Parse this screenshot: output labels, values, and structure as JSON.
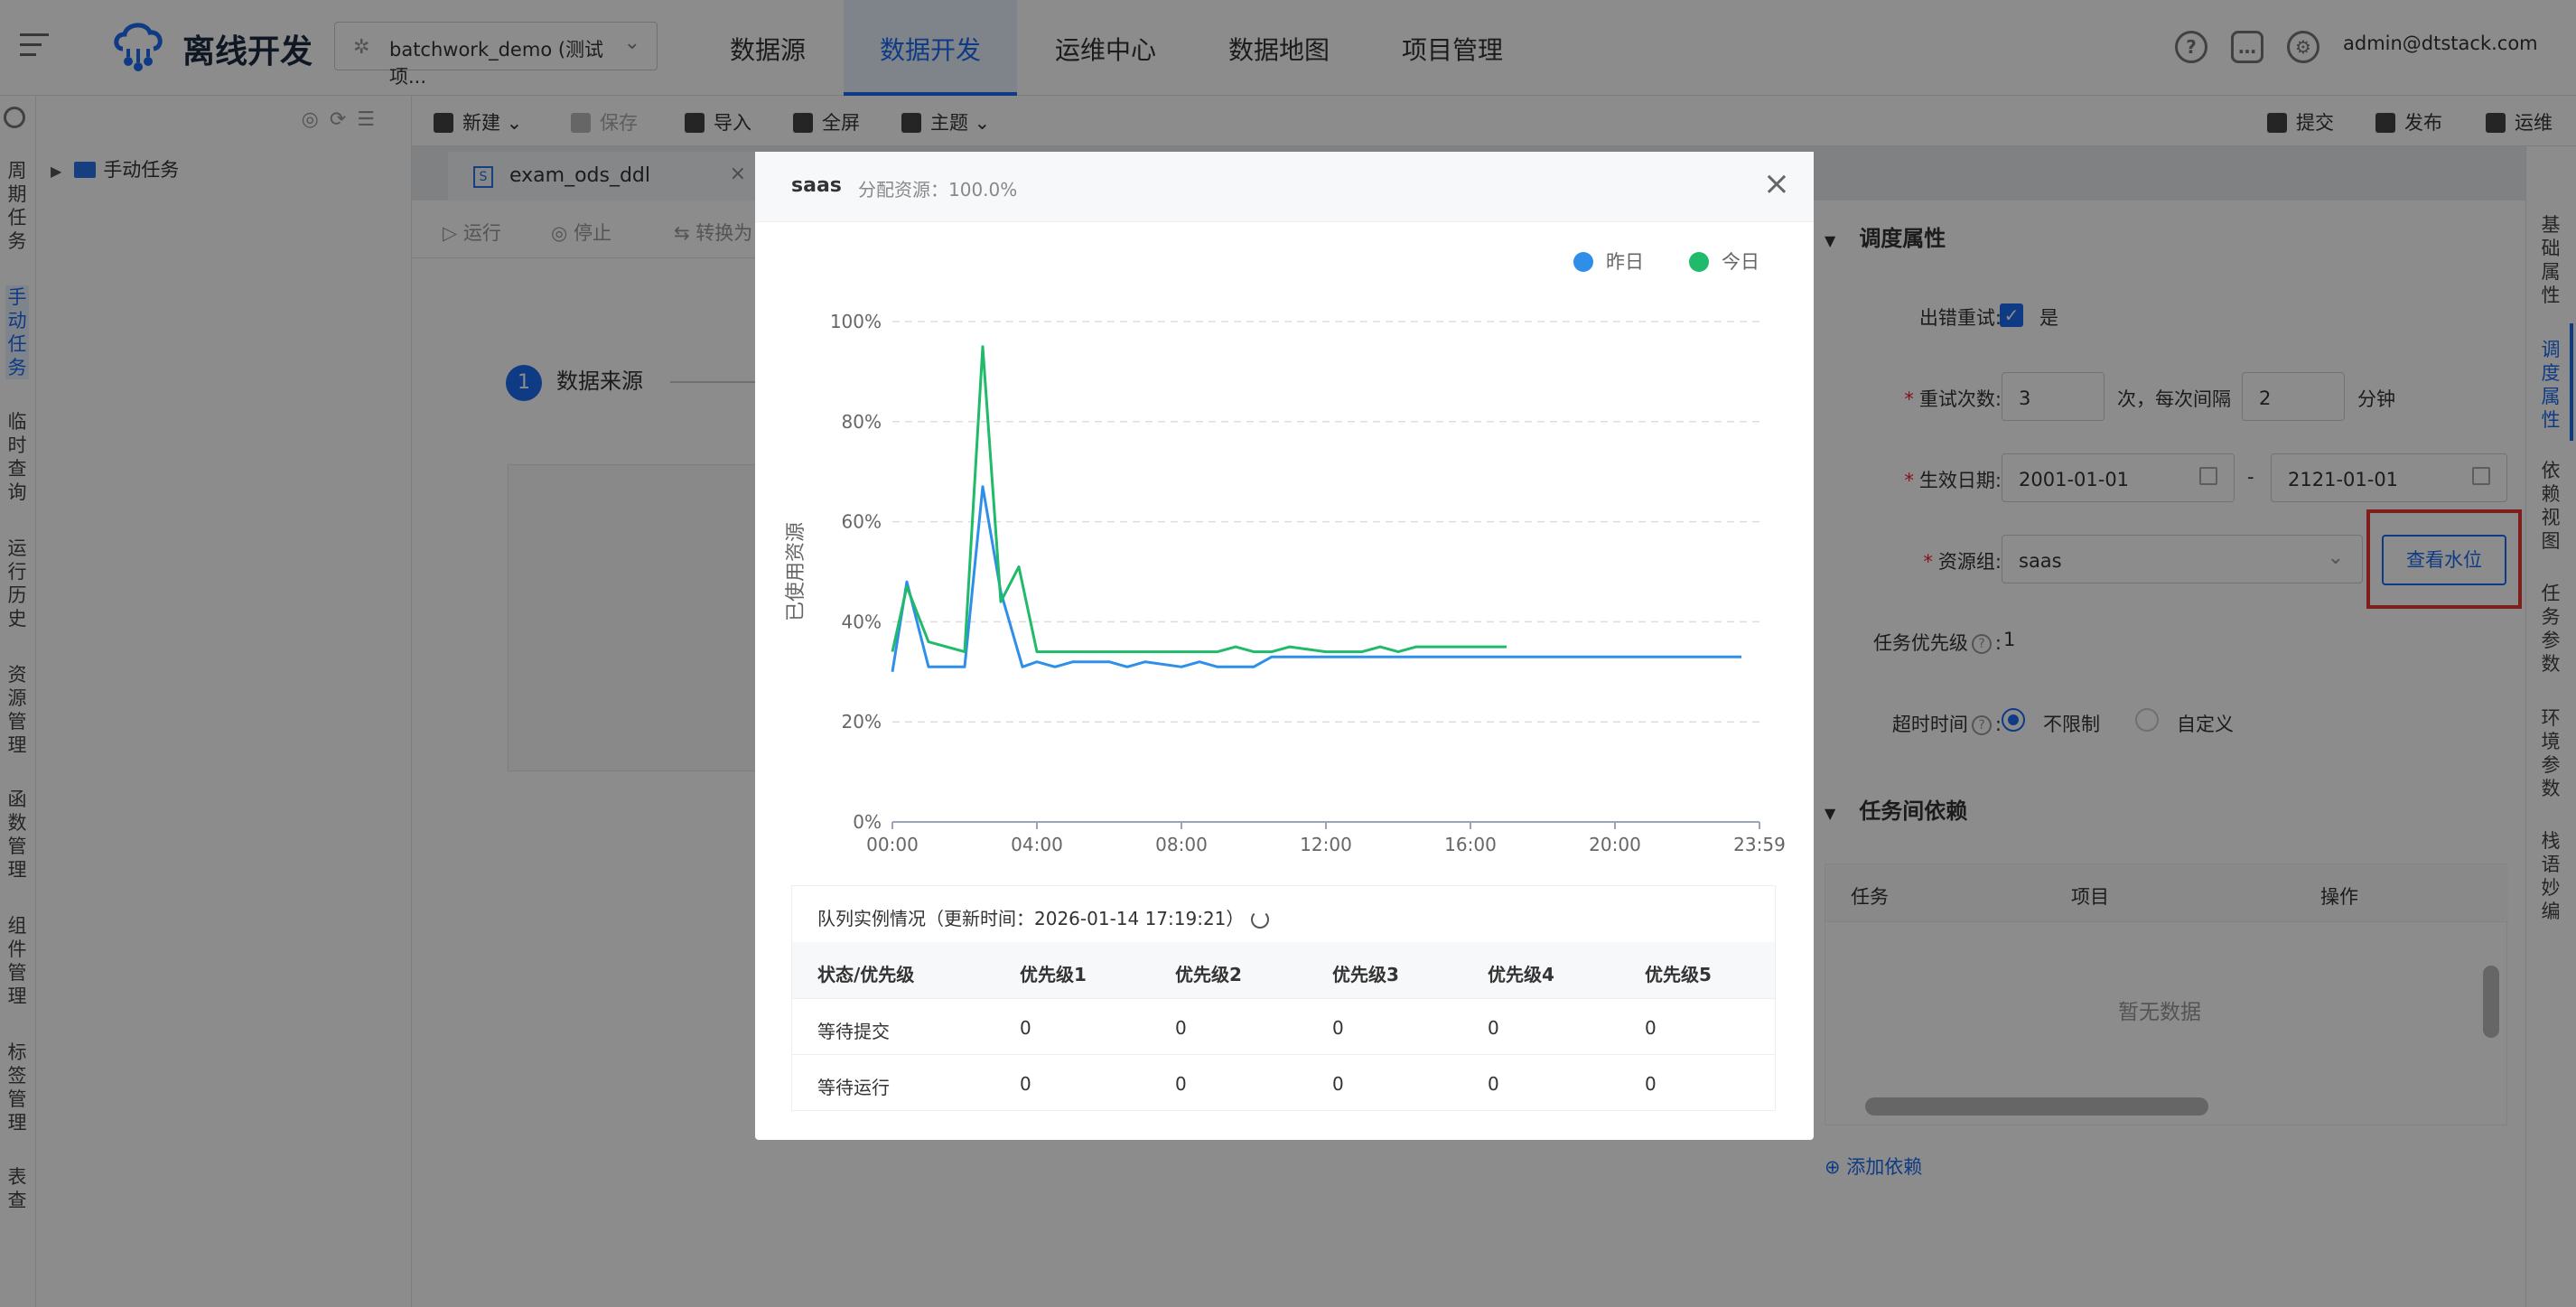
{
  "app": {
    "title": "离线开发",
    "user": "admin@dtstack.com"
  },
  "project_select": {
    "value": "batchwork_demo (测试项..."
  },
  "top_menu": [
    "数据源",
    "数据开发",
    "运维中心",
    "数据地图",
    "项目管理"
  ],
  "left_nav": [
    "周期任务",
    "手动任务",
    "临时查询",
    "运行历史",
    "资源管理",
    "函数管理",
    "组件管理",
    "标签管理",
    "表查询"
  ],
  "tree": {
    "root": "手动任务"
  },
  "toolbar": {
    "new": "新建",
    "save": "保存",
    "import": "导入",
    "fullscreen": "全屏",
    "theme": "主题",
    "submit": "提交",
    "publish": "发布",
    "ops": "运维"
  },
  "editor": {
    "tab": "exam_ods_ddl",
    "run": "运行",
    "stop": "停止",
    "convert": "转换为",
    "step1": "数据来源",
    "step1_num": "1"
  },
  "right_panel": {
    "section1": "调度属性",
    "retry_label": "出错重试:",
    "retry_value": "是",
    "retry_count_label": "重试次数:",
    "retry_count": "3",
    "interval_text": "次，每次间隔",
    "interval": "2",
    "minute": "分钟",
    "effective_label": "生效日期:",
    "start_date": "2001-01-01",
    "date_sep": "-",
    "end_date": "2121-01-01",
    "resource_label": "资源组:",
    "resource_value": "saas",
    "water_button": "查看水位",
    "priority_label": "任务优先级",
    "priority_value": "1",
    "timeout_label": "超时时间",
    "timeout_opt1": "不限制",
    "timeout_opt2": "自定义",
    "section2": "任务间依赖",
    "dep_cols": [
      "任务",
      "项目",
      "操作"
    ],
    "dep_empty": "暂无数据",
    "add_dep": "添加依赖"
  },
  "right_tabs": [
    "基础属性",
    "调度属性",
    "依赖视图",
    "任务参数",
    "环境参数",
    "栈语妙编"
  ],
  "modal": {
    "title": "saas",
    "subtitle": "分配资源：100.0%",
    "legend": [
      "昨日",
      "今日"
    ],
    "table_caption": "队列实例情况（更新时间：2026-01-14 17:19:21）",
    "columns": [
      "状态/优先级",
      "优先级1",
      "优先级2",
      "优先级3",
      "优先级4",
      "优先级5"
    ],
    "rows": [
      [
        "等待提交",
        "0",
        "0",
        "0",
        "0",
        "0"
      ],
      [
        "等待运行",
        "0",
        "0",
        "0",
        "0",
        "0"
      ]
    ]
  },
  "colors": {
    "accent": "#1d6bf0",
    "yesterday": "#2f8fe8",
    "today": "#1fba6a",
    "highlight_box": "#e53935"
  },
  "chart_data": {
    "type": "line",
    "ylabel": "已使用资源",
    "xlabel": "",
    "x_ticks": [
      "00:00",
      "04:00",
      "08:00",
      "12:00",
      "16:00",
      "20:00",
      "23:59"
    ],
    "y_ticks": [
      "0%",
      "20%",
      "40%",
      "60%",
      "80%",
      "100%"
    ],
    "ylim": [
      0,
      100
    ],
    "xlim_hours": [
      0,
      24
    ],
    "grid": true,
    "legend_position": "top-right",
    "series": [
      {
        "name": "昨日",
        "x_hours": [
          0,
          0.4,
          1,
          2,
          2.5,
          3,
          3.6,
          4,
          4.5,
          5,
          6,
          6.5,
          7,
          8,
          8.5,
          9,
          10,
          10.5,
          11,
          12,
          16,
          20,
          23.5
        ],
        "values": [
          30,
          48,
          31,
          31,
          67,
          46,
          31,
          32,
          31,
          32,
          32,
          31,
          32,
          31,
          32,
          31,
          31,
          33,
          33,
          33,
          33,
          33,
          33
        ]
      },
      {
        "name": "今日",
        "x_hours": [
          0,
          0.4,
          1,
          2,
          2.5,
          3,
          3.5,
          4,
          6,
          8,
          9,
          9.5,
          10,
          10.5,
          11,
          12,
          13,
          13.5,
          14,
          14.5,
          16,
          17
        ],
        "values": [
          34,
          47,
          36,
          34,
          95,
          44,
          51,
          34,
          34,
          34,
          34,
          35,
          34,
          34,
          35,
          34,
          34,
          35,
          34,
          35,
          35,
          35
        ]
      }
    ]
  }
}
